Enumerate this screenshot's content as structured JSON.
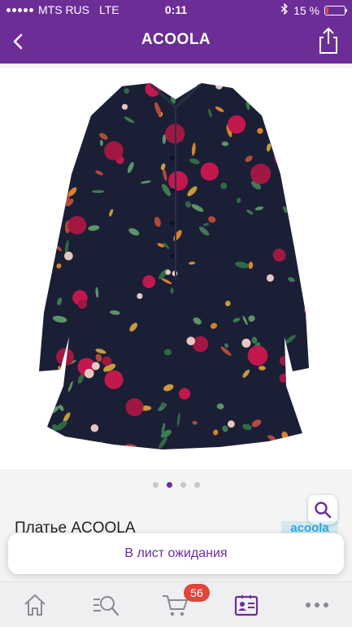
{
  "status_bar": {
    "carrier": "MTS RUS",
    "network": "LTE",
    "time": "0:11",
    "battery_percent": "15 %",
    "battery_level": 0.15
  },
  "nav": {
    "title": "ACOOLA",
    "back_icon": "chevron-left-icon",
    "share_icon": "share-icon"
  },
  "gallery": {
    "page_count": 4,
    "active_page": 2
  },
  "product": {
    "name": "Платье ACOOLA",
    "brand_logo_text": "acoola"
  },
  "actions": {
    "wait_list_label": "В лист ожидания"
  },
  "tabbar": {
    "items": [
      {
        "icon": "home-icon"
      },
      {
        "icon": "search-icon"
      },
      {
        "icon": "cart-icon",
        "badge": "56"
      },
      {
        "icon": "profile-icon"
      },
      {
        "icon": "more-icon"
      }
    ]
  },
  "colors": {
    "brand": "#6c2d97",
    "badge": "#e0463b",
    "dress_base": "#1a1f36"
  }
}
